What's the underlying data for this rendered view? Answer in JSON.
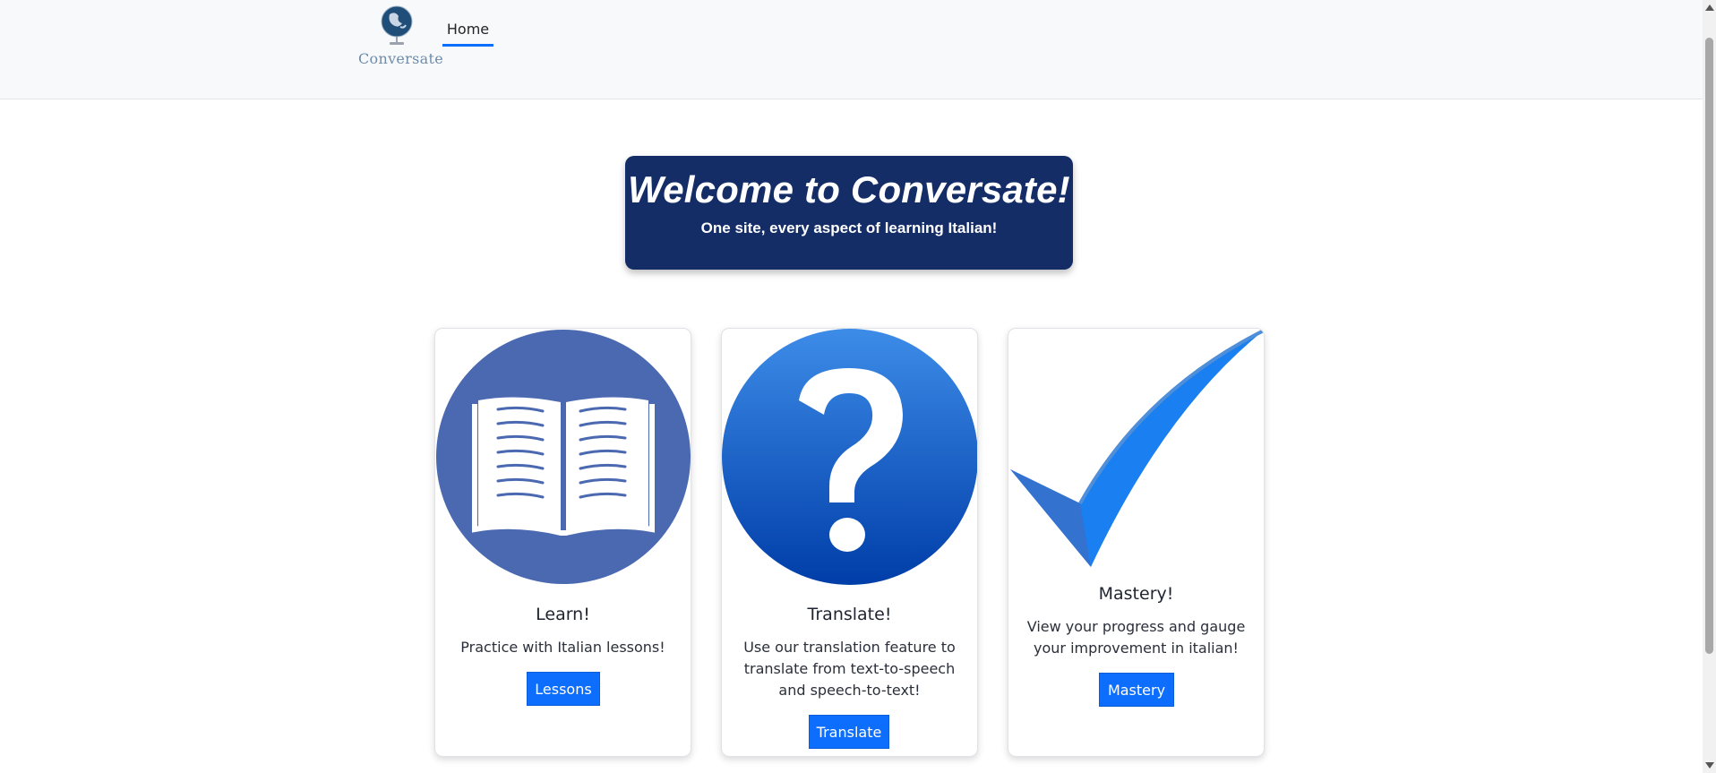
{
  "navbar": {
    "logo_text": "Conversate",
    "home_label": "Home"
  },
  "hero": {
    "title": "Welcome to Conversate!",
    "subtitle": "One site, every aspect of learning Italian!"
  },
  "cards": [
    {
      "icon": "open-book-icon",
      "title": "Learn!",
      "text": "Practice with Italian lessons!",
      "button": "Lessons"
    },
    {
      "icon": "question-mark-icon",
      "title": "Translate!",
      "text": "Use our translation feature to translate from text-to-speech and speech-to-text!",
      "button": "Translate"
    },
    {
      "icon": "checkmark-icon",
      "title": "Mastery!",
      "text": "View your progress and gauge your improvement in italian!",
      "button": "Mastery"
    }
  ],
  "colors": {
    "primary": "#0d6efd",
    "hero_bg": "#142d67",
    "book_circle": "#4a69b0",
    "question_circle": "#1f5fc9",
    "checkmark": "#1a7ff0"
  }
}
